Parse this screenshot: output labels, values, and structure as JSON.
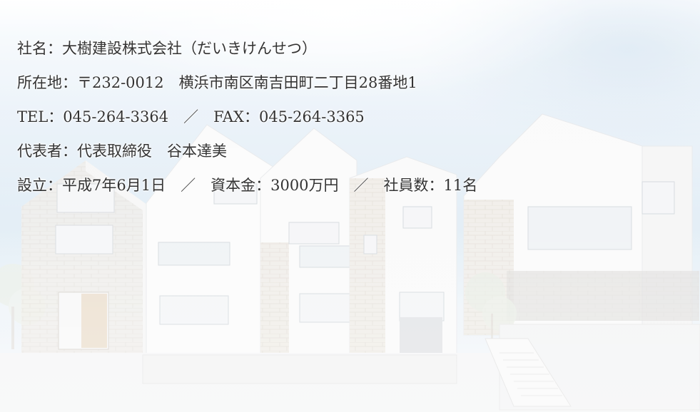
{
  "company": {
    "name_label": "社名：",
    "name_value": "大樹建設株式会社（だいきけんせつ）",
    "address_label": "所在地：",
    "address_value": "〒232-0012　横浜市南区南吉田町二丁目28番地1",
    "tel_label": "TEL：",
    "tel_value": "045-264-3364",
    "separator": "　／　",
    "fax_label": "FAX：",
    "fax_value": "045-264-3365",
    "rep_label": "代表者：",
    "rep_value": "代表取締役　谷本達美",
    "founded_label": "設立：",
    "founded_value": "平成7年6月1日",
    "capital_label": "資本金：",
    "capital_value": "3000万円",
    "employees_label": "社員数：",
    "employees_value": "11名"
  },
  "colors": {
    "text": "#333333",
    "sky": "#d6e6f3"
  }
}
